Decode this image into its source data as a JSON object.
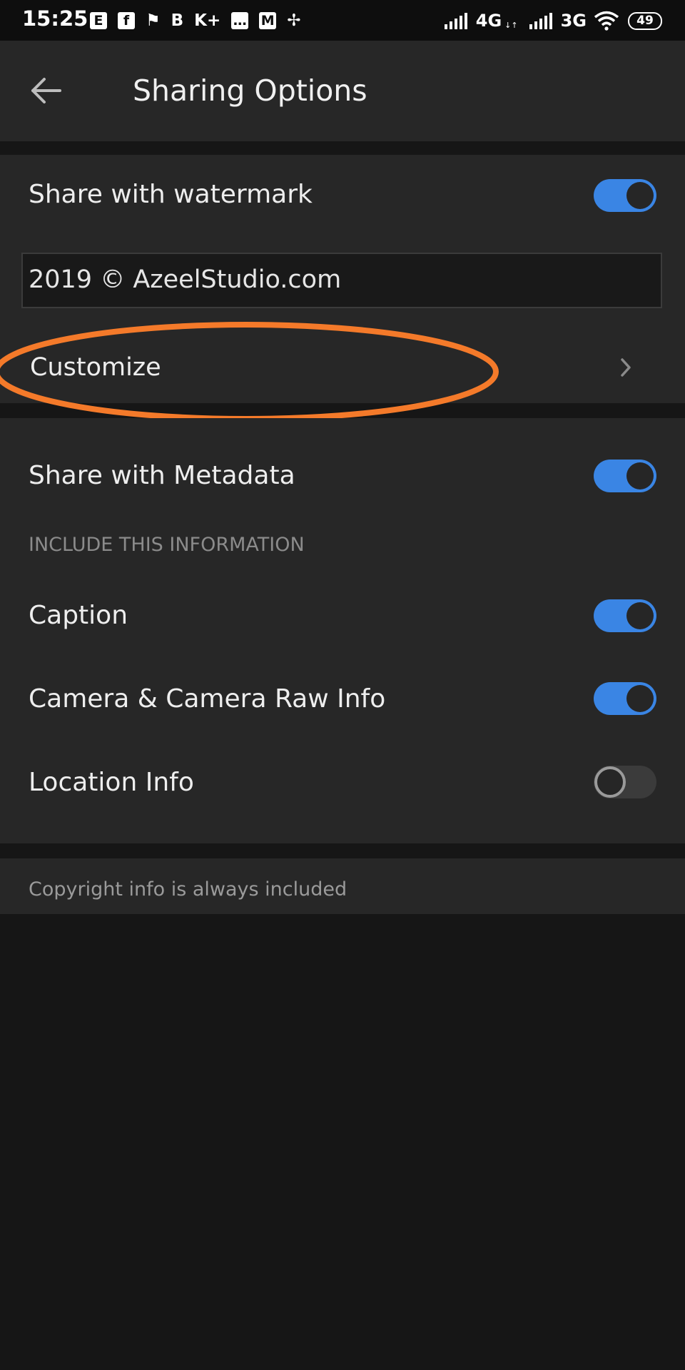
{
  "status_bar": {
    "time": "15:25",
    "notifications": [
      {
        "icon": "e-app-icon",
        "glyph": "E"
      },
      {
        "icon": "facebook-icon",
        "glyph": "f"
      },
      {
        "icon": "flag-icon",
        "glyph": "⚑"
      },
      {
        "icon": "b-app-icon",
        "glyph": "B"
      },
      {
        "icon": "kplus-icon",
        "glyph": "K+"
      },
      {
        "icon": "sms-icon",
        "glyph": "…"
      },
      {
        "icon": "gmail-icon",
        "glyph": "M"
      },
      {
        "icon": "pinwheel-icon",
        "glyph": "✢"
      }
    ],
    "network_1": "4G",
    "network_1_sub": "↓↑",
    "network_2": "3G",
    "battery": "49"
  },
  "header": {
    "title": "Sharing Options",
    "back_icon": "back-arrow-icon"
  },
  "watermark": {
    "label": "Share with watermark",
    "enabled": true,
    "text": "2019 © AzeelStudio.com",
    "customize_label": "Customize"
  },
  "metadata": {
    "label": "Share with Metadata",
    "enabled": true,
    "section_header": "INCLUDE THIS INFORMATION",
    "items": [
      {
        "label": "Caption",
        "enabled": true
      },
      {
        "label": "Camera & Camera Raw Info",
        "enabled": true
      },
      {
        "label": "Location Info",
        "enabled": false
      }
    ]
  },
  "footer": {
    "note": "Copyright info is always included"
  },
  "colors": {
    "toggle_on": "#3a85e4",
    "annotation": "#f47a2a",
    "surface": "#272727",
    "background": "#161616"
  }
}
